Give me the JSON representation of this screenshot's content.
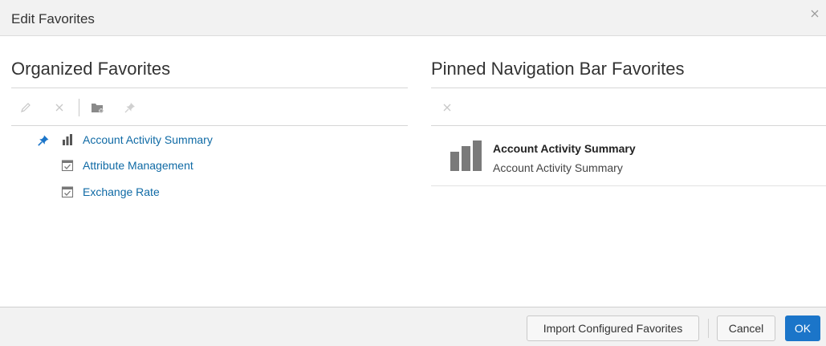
{
  "dialog": {
    "title": "Edit Favorites",
    "close_icon": "close-icon"
  },
  "organized": {
    "title": "Organized Favorites",
    "toolbar": {
      "icons": [
        "edit-icon",
        "delete-icon",
        "new-folder-icon",
        "pin-icon"
      ]
    },
    "items": [
      {
        "label": "Account Activity Summary",
        "icon": "bar-chart-icon",
        "pinned": true
      },
      {
        "label": "Attribute Management",
        "icon": "task-checkbox-icon",
        "pinned": false
      },
      {
        "label": "Exchange Rate",
        "icon": "task-checkbox-icon",
        "pinned": false
      }
    ]
  },
  "pinned": {
    "title": "Pinned Navigation Bar Favorites",
    "toolbar": {
      "icons": [
        "remove-icon"
      ]
    },
    "items": [
      {
        "title": "Account Activity Summary",
        "subtitle": "Account Activity Summary",
        "icon": "bar-chart-icon"
      }
    ]
  },
  "footer": {
    "import_label": "Import Configured Favorites",
    "cancel_label": "Cancel",
    "ok_label": "OK"
  },
  "colors": {
    "link": "#0f6aa5",
    "primary_button": "#1b75c9",
    "header_bg": "#f2f2f2",
    "pin": "#1b75c9"
  }
}
